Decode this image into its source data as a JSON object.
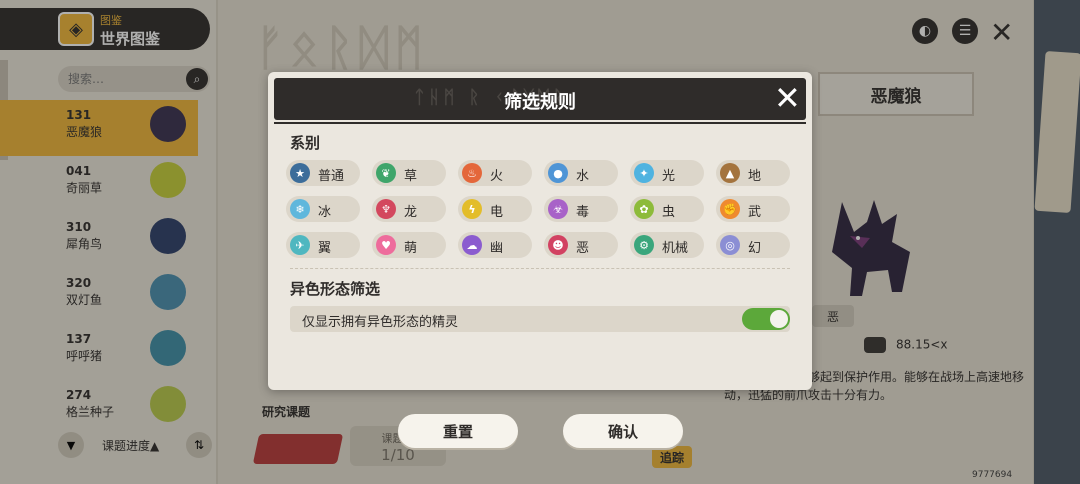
{
  "header": {
    "sub": "图鉴",
    "title": "世界图鉴"
  },
  "search": {
    "placeholder": "搜索…"
  },
  "pets": [
    {
      "num": "131",
      "name": "恶魔狼",
      "color": "#3a3050"
    },
    {
      "num": "041",
      "name": "奇丽草",
      "color": "#c6cf3a"
    },
    {
      "num": "310",
      "name": "犀角鸟",
      "color": "#2d3f6a"
    },
    {
      "num": "320",
      "name": "双灯鱼",
      "color": "#4a8fb0"
    },
    {
      "num": "137",
      "name": "呼呼猪",
      "color": "#3f8fa8"
    },
    {
      "num": "274",
      "name": "格兰种子",
      "color": "#b9c94a"
    }
  ],
  "left_bottom": {
    "progress": "课题进度▲"
  },
  "detail": {
    "name": "恶魔狼",
    "type": "恶",
    "weight": "88.15<x",
    "description": "…粗糙，似乎能够起到保护作用。能够在战场上高速地移动，迅猛的前爪攻击十分有力。",
    "research_label": "研究课题",
    "topic_label": "课题进",
    "topic_value": "1/10",
    "track": "追踪",
    "uid": "9777694"
  },
  "dialog": {
    "title": "筛选规则",
    "faint_title": "ᛏᚺᛗ ᚱ ᚲᛇᚷᛞᚱ",
    "section_series": "系别",
    "types": [
      {
        "label": "普通",
        "icon": "star-icon",
        "glyph": "★",
        "color": "#3c6d9a"
      },
      {
        "label": "草",
        "icon": "leaf-icon",
        "glyph": "❦",
        "color": "#3fa56a"
      },
      {
        "label": "火",
        "icon": "flame-icon",
        "glyph": "♨",
        "color": "#e4673a"
      },
      {
        "label": "水",
        "icon": "drop-icon",
        "glyph": "●",
        "color": "#4f95d6"
      },
      {
        "label": "光",
        "icon": "sparkle-icon",
        "glyph": "✦",
        "color": "#4fb3e0"
      },
      {
        "label": "地",
        "icon": "mountain-icon",
        "glyph": "▲",
        "color": "#a4743e"
      },
      {
        "label": "冰",
        "icon": "snowflake-icon",
        "glyph": "❄",
        "color": "#5fb7dc"
      },
      {
        "label": "龙",
        "icon": "dragon-icon",
        "glyph": "♆",
        "color": "#d3485e"
      },
      {
        "label": "电",
        "icon": "bolt-icon",
        "glyph": "ϟ",
        "color": "#e3bd2a"
      },
      {
        "label": "毒",
        "icon": "poison-icon",
        "glyph": "☣",
        "color": "#a862c8"
      },
      {
        "label": "虫",
        "icon": "bug-icon",
        "glyph": "✿",
        "color": "#8dbb3a"
      },
      {
        "label": "武",
        "icon": "fist-icon",
        "glyph": "✊",
        "color": "#ef8a2f"
      },
      {
        "label": "翼",
        "icon": "wing-icon",
        "glyph": "✈",
        "color": "#4fb7c0"
      },
      {
        "label": "萌",
        "icon": "heart-icon",
        "glyph": "♥",
        "color": "#ee6c9c"
      },
      {
        "label": "幽",
        "icon": "ghost-icon",
        "glyph": "☁",
        "color": "#8b5ccf"
      },
      {
        "label": "恶",
        "icon": "devil-icon",
        "glyph": "☻",
        "color": "#d24262"
      },
      {
        "label": "机械",
        "icon": "gear-icon",
        "glyph": "⚙",
        "color": "#3aa67c"
      },
      {
        "label": "幻",
        "icon": "spiral-icon",
        "glyph": "◎",
        "color": "#8b8ed4"
      }
    ],
    "section_shiny": "异色形态筛选",
    "shiny_toggle_label": "仅显示拥有异色形态的精灵",
    "shiny_toggle_on": true,
    "reset_label": "重置",
    "confirm_label": "确认"
  }
}
